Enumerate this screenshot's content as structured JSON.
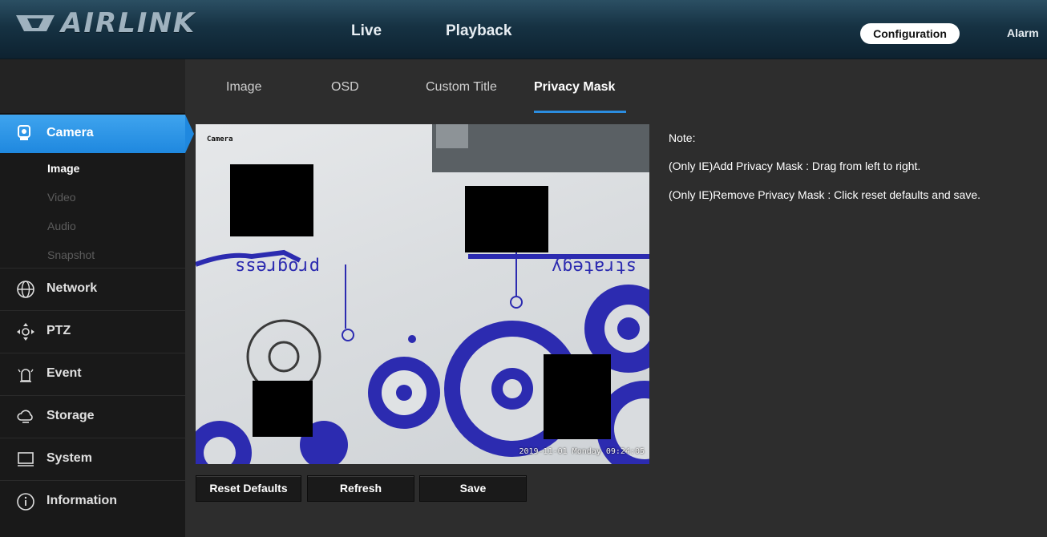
{
  "header": {
    "brand": "AIRLINK",
    "nav": {
      "live": "Live",
      "playback": "Playback",
      "configuration": "Configuration",
      "alarm": "Alarm"
    }
  },
  "sidebar": {
    "camera": {
      "label": "Camera",
      "icon": "camera-icon"
    },
    "camera_sub": [
      "Image",
      "Video",
      "Audio",
      "Snapshot"
    ],
    "items": [
      {
        "label": "Network",
        "icon": "globe-icon"
      },
      {
        "label": "PTZ",
        "icon": "ptz-icon"
      },
      {
        "label": "Event",
        "icon": "alarm-bell-icon"
      },
      {
        "label": "Storage",
        "icon": "cloud-storage-icon"
      },
      {
        "label": "System",
        "icon": "monitor-icon"
      },
      {
        "label": "Information",
        "icon": "info-icon"
      }
    ]
  },
  "tabs": [
    "Image",
    "OSD",
    "Custom Title",
    "Privacy Mask"
  ],
  "video": {
    "osd_channel": "Camera",
    "osd_time": "2019-11-01 Monday 09:24:05"
  },
  "buttons": {
    "reset": "Reset Defaults",
    "refresh": "Refresh",
    "save": "Save"
  },
  "notes": [
    "Note:",
    "(Only IE)Add Privacy Mask : Drag from left to right.",
    "(Only IE)Remove Privacy Mask : Click reset defaults and save."
  ],
  "colors": {
    "accent": "#1f88df",
    "header_dark": "#0d2230"
  }
}
